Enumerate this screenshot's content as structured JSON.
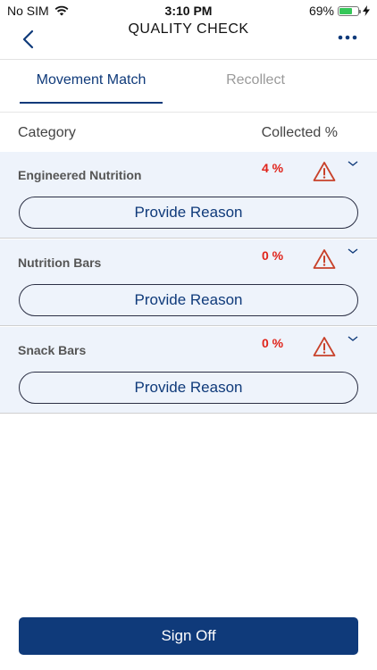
{
  "status_bar": {
    "carrier": "No SIM",
    "time": "3:10 PM",
    "battery": "69%",
    "battery_level": 0.69
  },
  "header": {
    "title": "QUALITY CHECK"
  },
  "tabs": [
    {
      "label": "Movement Match",
      "active": true
    },
    {
      "label": "Recollect",
      "active": false
    }
  ],
  "table": {
    "col_category": "Category",
    "col_collected": "Collected %"
  },
  "rows": [
    {
      "category": "Engineered Nutrition",
      "collected": "4 %",
      "button": "Provide Reason"
    },
    {
      "category": "Nutrition Bars",
      "collected": "0 %",
      "button": "Provide Reason"
    },
    {
      "category": "Snack Bars",
      "collected": "0 %",
      "button": "Provide Reason"
    }
  ],
  "footer": {
    "signoff_label": "Sign Off"
  },
  "colors": {
    "primary": "#0f3a7a",
    "alert": "#e0231a",
    "row_bg": "#eef3fb"
  },
  "icons": [
    "back-chevron-icon",
    "more-icon",
    "warning-icon",
    "chevron-down-icon",
    "wifi-icon",
    "battery-icon",
    "charging-icon"
  ]
}
